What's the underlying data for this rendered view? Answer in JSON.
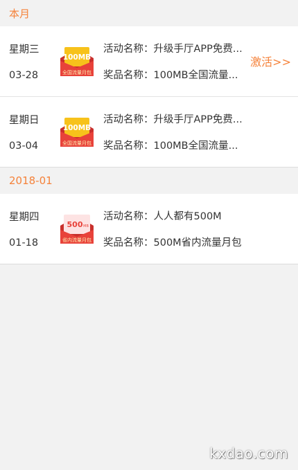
{
  "sections": [
    {
      "header": "本月",
      "records": [
        {
          "weekday": "星期三",
          "date": "03-28",
          "icon": "100mb-national-data-package-icon",
          "badge_top": "100MB",
          "badge_bottom": "全国流量月包",
          "activity_label": "活动名称：",
          "activity_value": "升级手厅APP免费...",
          "prize_label": "奖品名称：",
          "prize_value": "100MB全国流量...",
          "action": "激活>>"
        },
        {
          "weekday": "星期日",
          "date": "03-04",
          "icon": "100mb-national-data-package-icon",
          "badge_top": "100MB",
          "badge_bottom": "全国流量月包",
          "activity_label": "活动名称：",
          "activity_value": "升级手厅APP免费...",
          "prize_label": "奖品名称：",
          "prize_value": "100MB全国流量..."
        }
      ]
    },
    {
      "header": "2018-01",
      "records": [
        {
          "weekday": "星期四",
          "date": "01-18",
          "icon": "500m-provincial-data-package-icon",
          "badge_top": "500",
          "badge_top_unit": "MB",
          "badge_bottom": "省内流量月包",
          "activity_label": "活动名称：",
          "activity_value": "人人都有500M",
          "prize_label": "奖品名称：",
          "prize_value": "500M省内流量月包"
        }
      ]
    }
  ],
  "watermark": "kxdao.com",
  "colors": {
    "accent": "#f5823a",
    "envelope_red": "#e8423a",
    "card_yellow": "#f7c21b",
    "card_pink": "#fde3e3",
    "background": "#f2f2f2"
  }
}
